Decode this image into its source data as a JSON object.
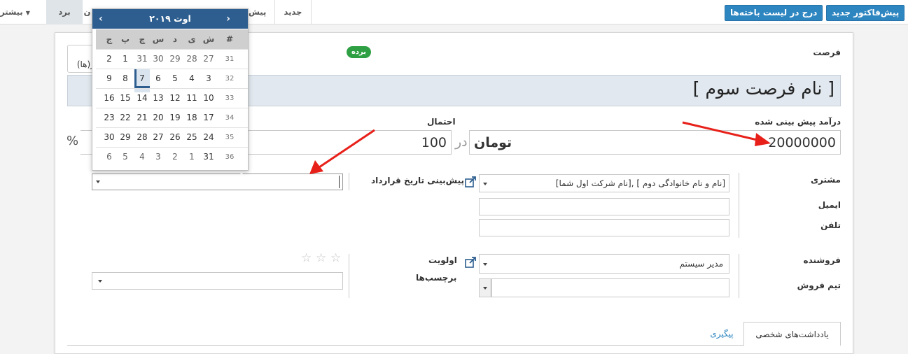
{
  "toolbar": {
    "new_quote_label": "پیش‌فاکتور جدید",
    "mark_lost_label": "درج در لیست باخته‌ها"
  },
  "stages": {
    "new": "جدید",
    "proposition_partial": "پیش",
    "partial_hidden": "ن",
    "won": "برد",
    "more": "بیشتر"
  },
  "form": {
    "section_label": "فرصت",
    "won_badge": "برده",
    "meetings_partial": "ر(ها)",
    "opportunity_name": "[ نام فرصت سوم ]",
    "expected_revenue_label": "درآمد پیش بینی شده",
    "expected_revenue_value": "20000000",
    "currency": "تومان",
    "in_word": "در",
    "probability_label": "احتمال",
    "probability_value": "100",
    "percent_sign": "%",
    "customer_label": "مشتری",
    "customer_value": "[نام شرکت اول شما], [ نام و نام خانوادگی دوم]",
    "email_label": "ایمیل",
    "email_value": "",
    "phone_label": "تلفن",
    "phone_value": "",
    "expected_closing_label": "پیش‌بینی تاریخ قرارداد",
    "expected_closing_value": "",
    "salesperson_label": "فروشنده",
    "salesperson_value": "مدیر سیستم",
    "sales_team_label": "تیم فروش",
    "sales_team_value": "",
    "priority_label": "اولویت",
    "tags_label": "برچسب‌ها",
    "tags_value": ""
  },
  "tabs": {
    "internal_notes": "یادداشت‌های شخصی",
    "followup": "پیگیری"
  },
  "datepicker": {
    "title": "اوت ۲۰۱۹",
    "prev_icon": "‹",
    "next_icon": "›",
    "weekdays": [
      "#",
      "ش",
      "ی",
      "د",
      "س",
      "چ",
      "پ",
      "ج"
    ],
    "weeks": [
      {
        "wk": "31",
        "days": [
          "27",
          "28",
          "29",
          "30",
          "31",
          "1",
          "2"
        ]
      },
      {
        "wk": "32",
        "days": [
          "3",
          "4",
          "5",
          "6",
          "7",
          "8",
          "9"
        ]
      },
      {
        "wk": "33",
        "days": [
          "10",
          "11",
          "12",
          "13",
          "14",
          "15",
          "16"
        ]
      },
      {
        "wk": "34",
        "days": [
          "17",
          "18",
          "19",
          "20",
          "21",
          "22",
          "23"
        ]
      },
      {
        "wk": "35",
        "days": [
          "24",
          "25",
          "26",
          "27",
          "28",
          "29",
          "30"
        ]
      },
      {
        "wk": "36",
        "days": [
          "31",
          "1",
          "2",
          "3",
          "4",
          "5",
          "6"
        ]
      }
    ],
    "today": "7",
    "highlight_color": "#2d5e8f"
  },
  "colors": {
    "primary_button": "#2e86c1",
    "badge_success": "#2ea043",
    "annotation_arrow": "#e8201a"
  }
}
